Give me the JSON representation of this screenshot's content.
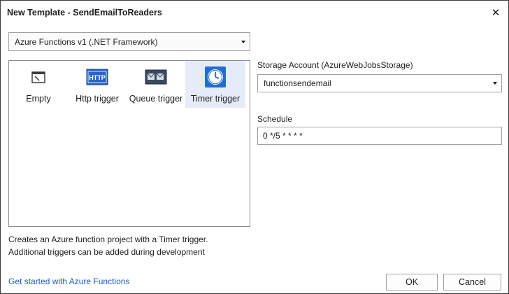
{
  "window": {
    "title": "New Template - SendEmailToReaders",
    "close_glyph": "✕"
  },
  "framework": {
    "selected": "Azure Functions v1 (.NET Framework)"
  },
  "templates": [
    {
      "label": "Empty",
      "icon": "empty-window-icon",
      "selected": false
    },
    {
      "label": "Http trigger",
      "icon": "http-icon",
      "selected": false
    },
    {
      "label": "Queue trigger",
      "icon": "queue-icon",
      "selected": false
    },
    {
      "label": "Timer trigger",
      "icon": "timer-clock-icon",
      "selected": true
    }
  ],
  "description": {
    "line1": "Creates an Azure function project with a Timer trigger.",
    "line2": "Additional triggers can be added during development"
  },
  "storage": {
    "label": "Storage Account (AzureWebJobsStorage)",
    "value": "functionsendemail"
  },
  "schedule": {
    "label": "Schedule",
    "value": "0 */5 * * * *"
  },
  "footer": {
    "link": "Get started with Azure Functions",
    "ok": "OK",
    "cancel": "Cancel"
  },
  "colors": {
    "selection": "#e5ecf7",
    "link": "#1a5fb4",
    "accent_blue": "#1f6fd1"
  }
}
